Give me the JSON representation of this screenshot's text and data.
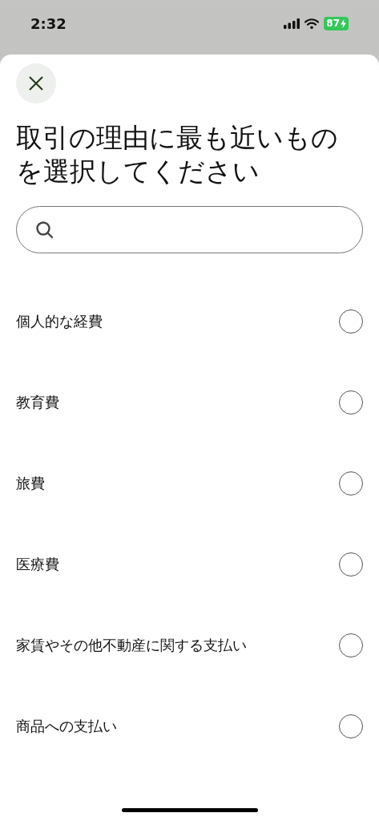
{
  "status_bar": {
    "time": "2:32",
    "battery": "87"
  },
  "title": "取引の理由に最も近いものを選択してください",
  "options": [
    {
      "label": "個人的な経費",
      "selected": false
    },
    {
      "label": "教育費",
      "selected": false
    },
    {
      "label": "旅費",
      "selected": false
    },
    {
      "label": "医療費",
      "selected": false
    },
    {
      "label": "家賃やその他不動産に関する支払い",
      "selected": false
    },
    {
      "label": "商品への支払い",
      "selected": false
    }
  ]
}
